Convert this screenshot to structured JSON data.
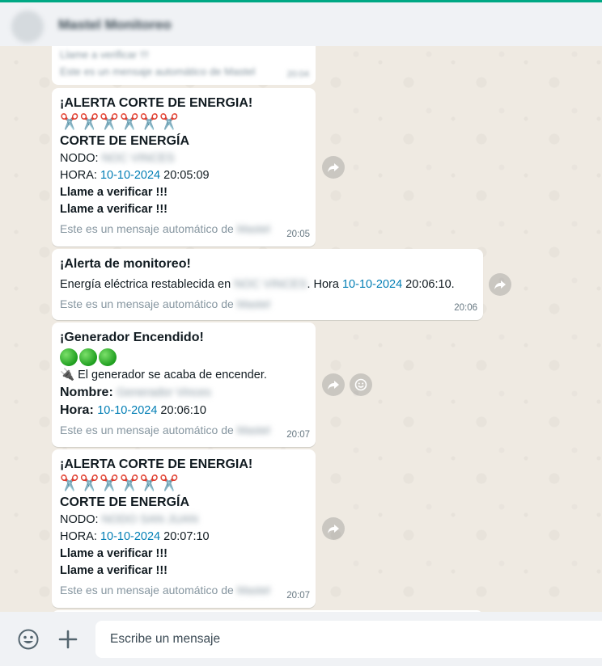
{
  "header": {
    "contact_name": "Mastel Monitoreo"
  },
  "previous_message": {
    "line1": "Llame a verificar !!!",
    "line2": "Este es un mensaje automático de Mastel",
    "time": "20:04"
  },
  "messages": [
    {
      "title": "¡ALERTA CORTE DE ENERGIA!",
      "emoji": "✂️✂️✂️✂️✂️✂️",
      "subtitle": "CORTE DE ENERGÍA",
      "node_label": "NODO: ",
      "node_value": "NOC VINCES",
      "hour_label": "HORA: ",
      "hour_date": "10-10-2024",
      "hour_time": " 20:05:09",
      "call1": "Llame a verificar !!!",
      "call2": "Llame a verificar !!!",
      "footer_text": "Este es un mensaje automático de ",
      "footer_sender": "Mastel",
      "time": "20:05"
    },
    {
      "title": "¡Alerta de monitoreo!",
      "body_prefix": "Energía eléctrica restablecida en ",
      "body_node": "NOC VINCES",
      "body_mid": ". Hora ",
      "body_date": "10-10-2024",
      "body_time": " 20:06:10.",
      "footer_text": "Este es un mensaje automático de ",
      "footer_sender": "Mastel",
      "time": "20:06"
    },
    {
      "title": "¡Generador Encendido!",
      "plug_emoji": "🔌",
      "body": " El generador se acaba de encender.",
      "name_label": "Nombre: ",
      "name_value": "Generador Vinces",
      "hour_label": "Hora: ",
      "hour_date": "10-10-2024",
      "hour_time": " 20:06:10",
      "footer_text": "Este es un mensaje automático de ",
      "footer_sender": "Mastel",
      "time": "20:07"
    },
    {
      "title": "¡ALERTA CORTE DE ENERGIA!",
      "emoji": "✂️✂️✂️✂️✂️✂️",
      "subtitle": "CORTE DE ENERGÍA",
      "node_label": "NODO: ",
      "node_value": "NODO SAN JUAN",
      "hour_label": "HORA: ",
      "hour_date": "10-10-2024",
      "hour_time": " 20:07:10",
      "call1": "Llame a verificar !!!",
      "call2": "Llame a verificar !!!",
      "footer_text": "Este es un mensaje automático de ",
      "footer_sender": "Mastel",
      "time": "20:07"
    }
  ],
  "composer": {
    "placeholder": "Escribe un mensaje"
  },
  "icons": {
    "forward": "forward-icon",
    "reaction": "smiley-icon",
    "emoji": "emoji-icon",
    "attach": "plus-icon"
  },
  "colors": {
    "link": "#027eb5",
    "accent": "#00a884",
    "background": "#efeae2"
  }
}
